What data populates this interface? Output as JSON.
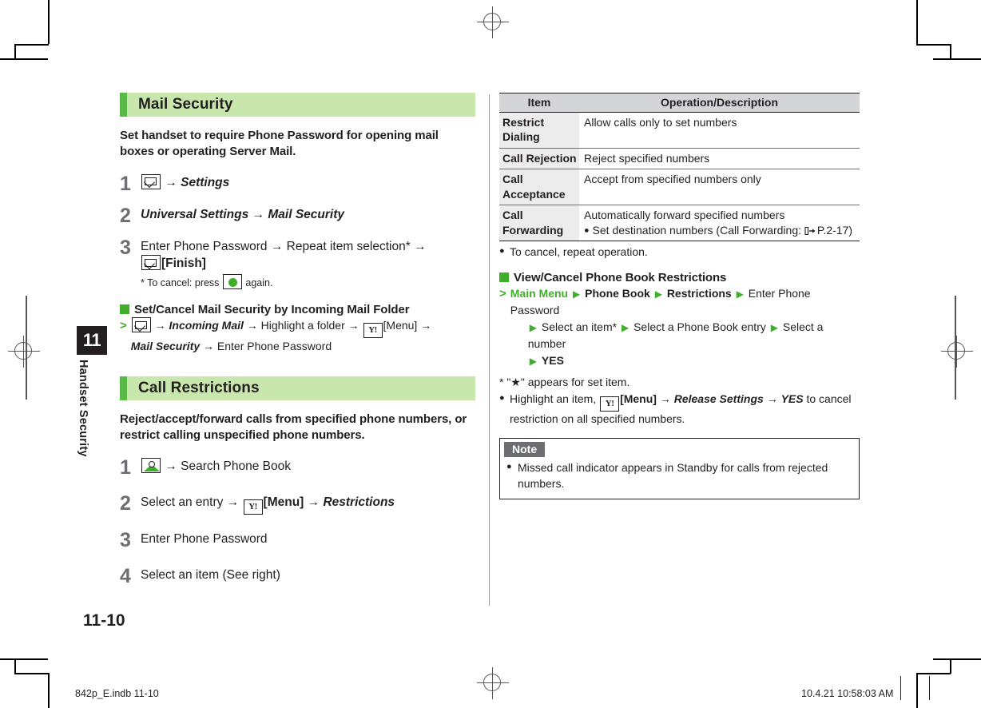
{
  "chapter": {
    "number": "11",
    "title": "Handset Security"
  },
  "page_number": "11-10",
  "footer": {
    "left": "842p_E.indb   11-10",
    "right": "10.4.21   10:58:03 AM"
  },
  "left_column": {
    "sections": [
      {
        "heading": "Mail Security",
        "lead": "Set handset to require Phone Password for opening mail boxes or operating Server Mail.",
        "steps": [
          {
            "num": "1",
            "icon": "mail-key-icon",
            "arrow": "→",
            "text_italic": "Settings"
          },
          {
            "num": "2",
            "text_italic_1": "Universal Settings",
            "arrow": "→",
            "text_italic_2": "Mail Security"
          },
          {
            "num": "3",
            "line1_a": "Enter Phone Password",
            "arrow1": "→",
            "line1_b": "Repeat item selection*",
            "arrow2": "→",
            "line2_bold": "[Finish]",
            "footnote_a": "* To cancel: press",
            "footnote_b": "again."
          }
        ],
        "subhead": "Set/Cancel Mail Security by Incoming Mail Folder",
        "subhead_path": {
          "gt": ">",
          "arrow": "→",
          "p1_italic": "Incoming Mail",
          "p2": "Highlight a folder",
          "p3_bold": "[Menu]",
          "p4_italic": "Mail Security",
          "p5": "Enter Phone Password"
        }
      },
      {
        "heading": "Call Restrictions",
        "lead": "Reject/accept/forward calls from specified phone numbers, or restrict calling unspecified phone numbers.",
        "steps": [
          {
            "num": "1",
            "icon": "phone-book-key-icon",
            "arrow": "→",
            "text": "Search Phone Book"
          },
          {
            "num": "2",
            "text_a": "Select an entry",
            "arrow1": "→",
            "menu_bold": "[Menu]",
            "arrow2": "→",
            "text_italic": "Restrictions"
          },
          {
            "num": "3",
            "text": "Enter Phone Password"
          },
          {
            "num": "4",
            "text": "Select an item (See right)"
          }
        ]
      }
    ]
  },
  "right_column": {
    "table": {
      "headers": [
        "Item",
        "Operation/Description"
      ],
      "rows": [
        {
          "item": "Restrict Dialing",
          "desc": "Allow calls only to set numbers",
          "sub": ""
        },
        {
          "item": "Call Rejection",
          "desc": "Reject specified numbers",
          "sub": ""
        },
        {
          "item": "Call Acceptance",
          "desc": "Accept from specified numbers only",
          "sub": ""
        },
        {
          "item": "Call Forwarding",
          "desc": "Automatically forward specified numbers",
          "sub": "Set destination numbers (Call Forwarding:",
          "sub_ref": "P.2-17)"
        }
      ]
    },
    "cancel_bullet": "To cancel, repeat operation.",
    "subhead": "View/Cancel Phone Book Restrictions",
    "crumb": {
      "gt": ">",
      "main_menu": "Main Menu",
      "i1": "Phone Book",
      "i2": "Restrictions",
      "i3": "Enter Phone Password",
      "i4": "Select an item*",
      "i5": "Select a Phone Book entry",
      "i6": "Select a number",
      "i7": "YES"
    },
    "star_note": "* \"★\" appears for set item.",
    "release_bullet": {
      "a": "Highlight an item,",
      "menu_bold": "[Menu]",
      "arrow1": "→",
      "italic1": "Release Settings",
      "arrow2": "→",
      "italic2": "YES",
      "b": "to cancel restriction on all specified numbers."
    },
    "note": {
      "label": "Note",
      "text": "Missed call indicator appears in Standby for calls from rejected numbers."
    }
  },
  "colors": {
    "section_heading_bg": "#c7e7ad",
    "section_heading_bar": "#58b947",
    "accent_green": "#3fae2a",
    "table_header_bg": "#d4d5d7",
    "table_item_bg": "#ececed",
    "note_label_bg": "#6d6e71",
    "step_number": "#6d6e71",
    "text": "#231f20"
  }
}
